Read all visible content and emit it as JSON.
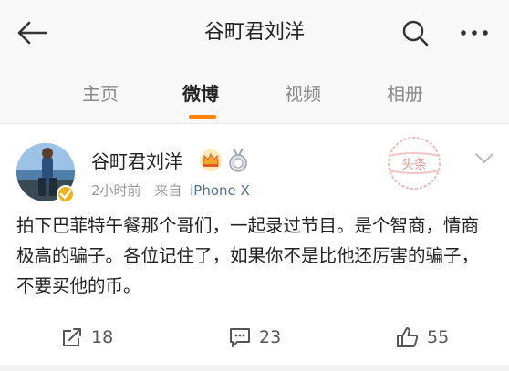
{
  "header": {
    "title": "谷町君刘洋",
    "back_icon": "arrow-left-icon",
    "search_icon": "search-icon",
    "more_icon": "more-dots-icon"
  },
  "tabs": [
    {
      "label": "主页"
    },
    {
      "label": "微博",
      "active": true
    },
    {
      "label": "视频"
    },
    {
      "label": "相册"
    }
  ],
  "accent_color": "#ff8200",
  "post": {
    "author": "谷町君刘洋",
    "time": "2小时前",
    "source_prefix": "来自",
    "device": "iPhone X",
    "stamp_text": "头条",
    "text": "拍下巴菲特午餐那个哥们，一起录过节目。是个智商，情商极高的骗子。各位记住了，如果你不是比他还厉害的骗子，不要买他的币。",
    "actions": {
      "repost_count": "18",
      "comment_count": "23",
      "like_count": "55"
    }
  }
}
